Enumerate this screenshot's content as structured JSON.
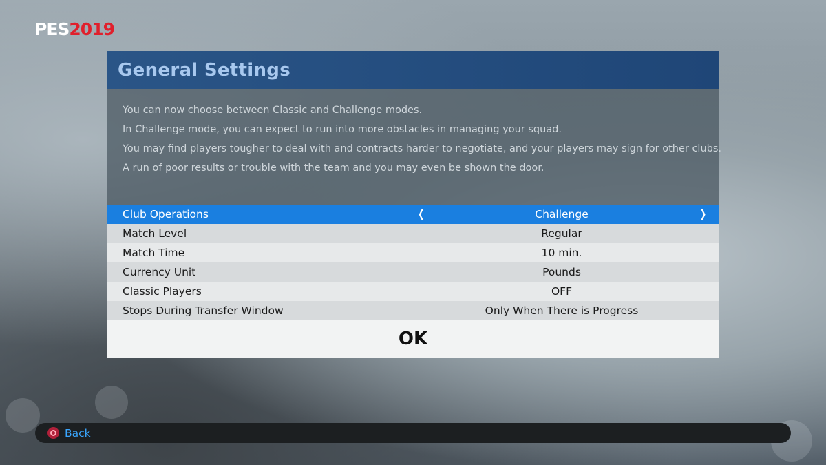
{
  "logo": {
    "pes": "PES",
    "year": "2019"
  },
  "panel": {
    "title": "General Settings",
    "description": [
      "You can now choose between Classic and Challenge modes.",
      "In Challenge mode, you can expect to run into more obstacles in managing your squad.",
      "You may find players tougher to deal with and contracts harder to negotiate, and your players may sign for other clubs.",
      "A run of poor results or trouble with the team and you may even be shown the door."
    ],
    "settings": [
      {
        "label": "Club Operations",
        "value": "Challenge",
        "selected": true
      },
      {
        "label": "Match Level",
        "value": "Regular"
      },
      {
        "label": "Match Time",
        "value": "10 min."
      },
      {
        "label": "Currency Unit",
        "value": "Pounds"
      },
      {
        "label": "Classic Players",
        "value": "OFF"
      },
      {
        "label": "Stops During Transfer Window",
        "value": "Only When There is Progress"
      }
    ],
    "arrows": {
      "left": "❬",
      "right": "❭"
    },
    "ok_label": "OK"
  },
  "footer": {
    "back_icon": "circle-button-icon",
    "back_label": "Back"
  },
  "colors": {
    "header": "#2a5587",
    "selected_row": "#1a7fe0",
    "back_text": "#3aa6ff",
    "logo_red": "#e0202c"
  }
}
